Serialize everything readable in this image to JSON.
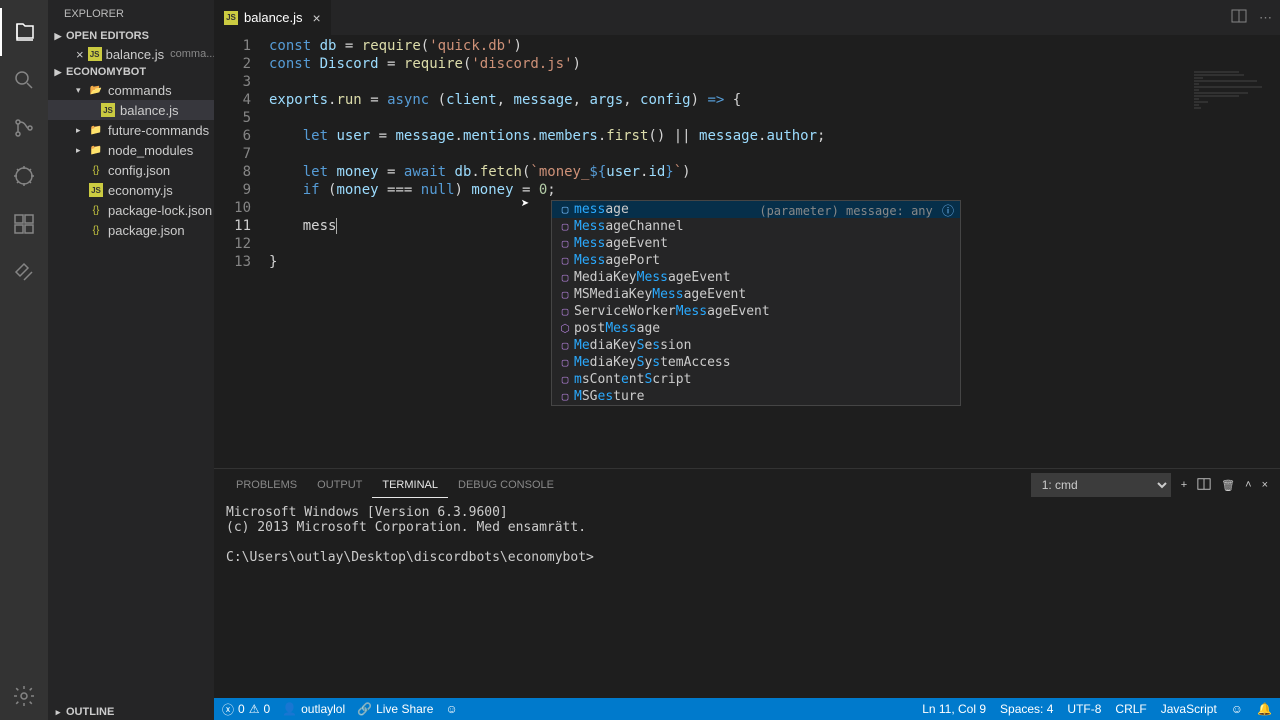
{
  "sidebar": {
    "title": "EXPLORER",
    "openEditors": "OPEN EDITORS",
    "project": "ECONOMYBOT",
    "outline": "OUTLINE",
    "openFile": {
      "name": "balance.js",
      "desc": "comma..."
    },
    "tree": {
      "commands": "commands",
      "balance": "balance.js",
      "future": "future-commands",
      "node_modules": "node_modules",
      "config": "config.json",
      "economy": "economy.js",
      "pkglock": "package-lock.json",
      "pkg": "package.json"
    }
  },
  "tab": {
    "name": "balance.js"
  },
  "code": {
    "typed": "mess"
  },
  "suggest": {
    "hint": "(parameter) message: any",
    "items": [
      {
        "pre": "mess",
        "match": "age",
        "type": "var"
      },
      {
        "pre": "Mess",
        "match": "ageChannel",
        "type": "cls"
      },
      {
        "pre": "Mess",
        "match": "ageEvent",
        "type": "cls"
      },
      {
        "pre": "Mess",
        "match": "agePort",
        "type": "cls"
      },
      {
        "pre": "MediaKey",
        "mid": "Mess",
        "match": "ageEvent",
        "type": "cls"
      },
      {
        "pre": "MSMediaKey",
        "mid": "Mess",
        "match": "ageEvent",
        "type": "cls"
      },
      {
        "pre": "ServiceWorker",
        "mid": "Mess",
        "match": "ageEvent",
        "type": "cls"
      },
      {
        "pre": "post",
        "mid": "Mess",
        "match": "age",
        "type": "fn"
      },
      {
        "pre": "Me",
        "mid": "diaKey",
        "m2": "Se",
        "m3": "s",
        "match": "sion",
        "type": "cls",
        "raw": "MediaKeySession"
      },
      {
        "pre": "Me",
        "mid": "diaKey",
        "m2": "Sy",
        "m3": "s",
        "match": "temAccess",
        "type": "cls",
        "raw": "MediaKeySystemAccess"
      },
      {
        "pre": "ms",
        "mid": "Cont",
        "m2": "e",
        "m3": "ntS",
        "match": "cript",
        "type": "cls",
        "raw": "msContentScript"
      },
      {
        "pre": "MS",
        "mid": "G",
        "m2": "es",
        "match": "ture",
        "type": "cls",
        "raw": "MSGesture"
      }
    ]
  },
  "panel": {
    "tabs": {
      "problems": "PROBLEMS",
      "output": "OUTPUT",
      "terminal": "TERMINAL",
      "debug": "DEBUG CONSOLE"
    },
    "termSelect": "1: cmd",
    "body": "Microsoft Windows [Version 6.3.9600]\n(c) 2013 Microsoft Corporation. Med ensamrätt.\n\nC:\\Users\\outlay\\Desktop\\discordbots\\economybot>"
  },
  "status": {
    "errors": "0",
    "warnings": "0",
    "user": "outlaylol",
    "liveshare": "Live Share",
    "pos": "Ln 11, Col 9",
    "spaces": "Spaces: 4",
    "encoding": "UTF-8",
    "eol": "CRLF",
    "lang": "JavaScript"
  }
}
